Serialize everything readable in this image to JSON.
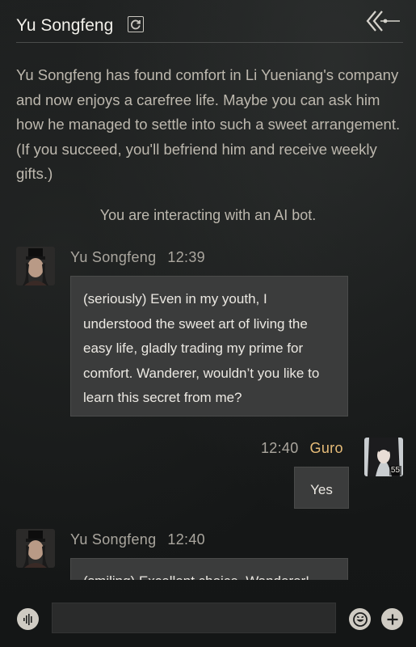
{
  "header": {
    "title": "Yu Songfeng"
  },
  "description": "Yu Songfeng has found comfort in Li Yueniang's company and now enjoys a carefree life. Maybe you can ask him how he managed to settle into such a sweet arrangement. (If you succeed, you'll befriend him and receive weekly gifts.)",
  "notice": "You are interacting with an AI bot.",
  "messages": [
    {
      "sender": "Yu Songfeng",
      "time": "12:39",
      "text": "(seriously) Even in my youth, I understood the sweet art of living the easy life, gladly trading my prime for comfort. Wanderer, wouldn’t you like to learn this secret from me?"
    },
    {
      "sender": "Guro",
      "time": "12:40",
      "text": "Yes",
      "level": "55"
    },
    {
      "sender": "Yu Songfeng",
      "time": "12:40",
      "text": "(smiling) Excellent choice, Wanderer!"
    }
  ],
  "input": {
    "value": ""
  },
  "icons": {
    "refresh": "refresh-icon",
    "back": "back-arrow-icon",
    "voice": "voice-icon",
    "emoji": "emoji-icon",
    "plus": "plus-icon"
  },
  "colors": {
    "player_name": "#e6bc78",
    "bubble": "#3b3c3c",
    "background": "#151717"
  }
}
